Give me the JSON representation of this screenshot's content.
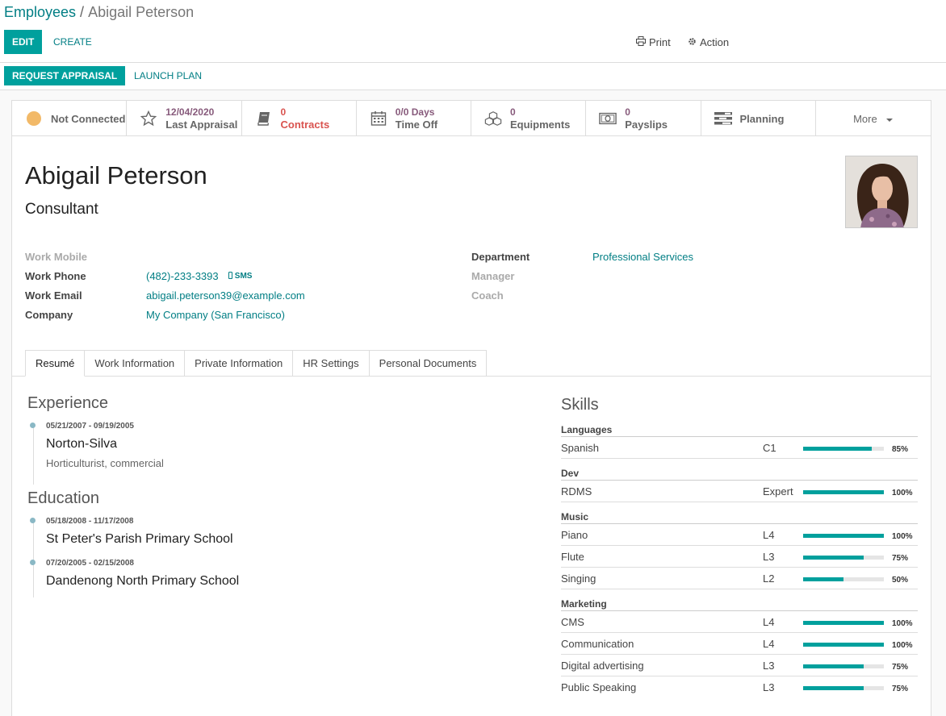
{
  "breadcrumb": {
    "parent": "Employees",
    "separator": "/",
    "current": "Abigail Peterson"
  },
  "toolbar": {
    "edit": "Edit",
    "create": "Create",
    "print": "Print",
    "action": "Action"
  },
  "statusbar": {
    "request_appraisal": "Request Appraisal",
    "launch_plan": "Launch Plan"
  },
  "smart_buttons": [
    {
      "icon": "presence-dot-icon",
      "value": "",
      "label": "Not Connected"
    },
    {
      "icon": "star-icon",
      "value": "12/04/2020",
      "label": "Last Appraisal"
    },
    {
      "icon": "book-icon",
      "value": "0",
      "label": "Contracts"
    },
    {
      "icon": "calendar-icon",
      "value": "0/0 Days",
      "label": "Time Off"
    },
    {
      "icon": "cubes-icon",
      "value": "0",
      "label": "Equipments"
    },
    {
      "icon": "money-icon",
      "value": "0",
      "label": "Payslips"
    },
    {
      "icon": "tasks-icon",
      "value": "",
      "label": "Planning"
    },
    {
      "icon": "caret-down-icon",
      "value": "",
      "label": "More"
    }
  ],
  "colors": {
    "accent": "#00a09d",
    "link": "#017e84",
    "value": "#875a7b",
    "danger": "#d9534f",
    "presence": "#f0ad4e"
  },
  "employee": {
    "name": "Abigail Peterson",
    "job_title": "Consultant"
  },
  "fields": {
    "work_mobile": {
      "label": "Work Mobile",
      "value": ""
    },
    "work_phone": {
      "label": "Work Phone",
      "value": "(482)-233-3393",
      "sms": "SMS"
    },
    "work_email": {
      "label": "Work Email",
      "value": "abigail.peterson39@example.com"
    },
    "company": {
      "label": "Company",
      "value": "My Company (San Francisco)"
    },
    "department": {
      "label": "Department",
      "value": "Professional Services"
    },
    "manager": {
      "label": "Manager",
      "value": ""
    },
    "coach": {
      "label": "Coach",
      "value": ""
    }
  },
  "tabs": [
    "Resumé",
    "Work Information",
    "Private Information",
    "HR Settings",
    "Personal Documents"
  ],
  "resume": {
    "experience_title": "Experience",
    "experience": [
      {
        "dates": "05/21/2007 - 09/19/2005",
        "name": "Norton-Silva",
        "description": "Horticulturist, commercial"
      }
    ],
    "education_title": "Education",
    "education": [
      {
        "dates": "05/18/2008 - 11/17/2008",
        "name": "St Peter's Parish Primary School"
      },
      {
        "dates": "07/20/2005 - 02/15/2008",
        "name": "Dandenong North Primary School"
      }
    ]
  },
  "skills": {
    "title": "Skills",
    "groups": [
      {
        "name": "Languages",
        "items": [
          {
            "name": "Spanish",
            "level": "C1",
            "progress": 85,
            "pct": "85%"
          }
        ]
      },
      {
        "name": "Dev",
        "items": [
          {
            "name": "RDMS",
            "level": "Expert",
            "progress": 100,
            "pct": "100%"
          }
        ]
      },
      {
        "name": "Music",
        "items": [
          {
            "name": "Piano",
            "level": "L4",
            "progress": 100,
            "pct": "100%"
          },
          {
            "name": "Flute",
            "level": "L3",
            "progress": 75,
            "pct": "75%"
          },
          {
            "name": "Singing",
            "level": "L2",
            "progress": 50,
            "pct": "50%"
          }
        ]
      },
      {
        "name": "Marketing",
        "items": [
          {
            "name": "CMS",
            "level": "L4",
            "progress": 100,
            "pct": "100%"
          },
          {
            "name": "Communication",
            "level": "L4",
            "progress": 100,
            "pct": "100%"
          },
          {
            "name": "Digital advertising",
            "level": "L3",
            "progress": 75,
            "pct": "75%"
          },
          {
            "name": "Public Speaking",
            "level": "L3",
            "progress": 75,
            "pct": "75%"
          }
        ]
      }
    ]
  }
}
